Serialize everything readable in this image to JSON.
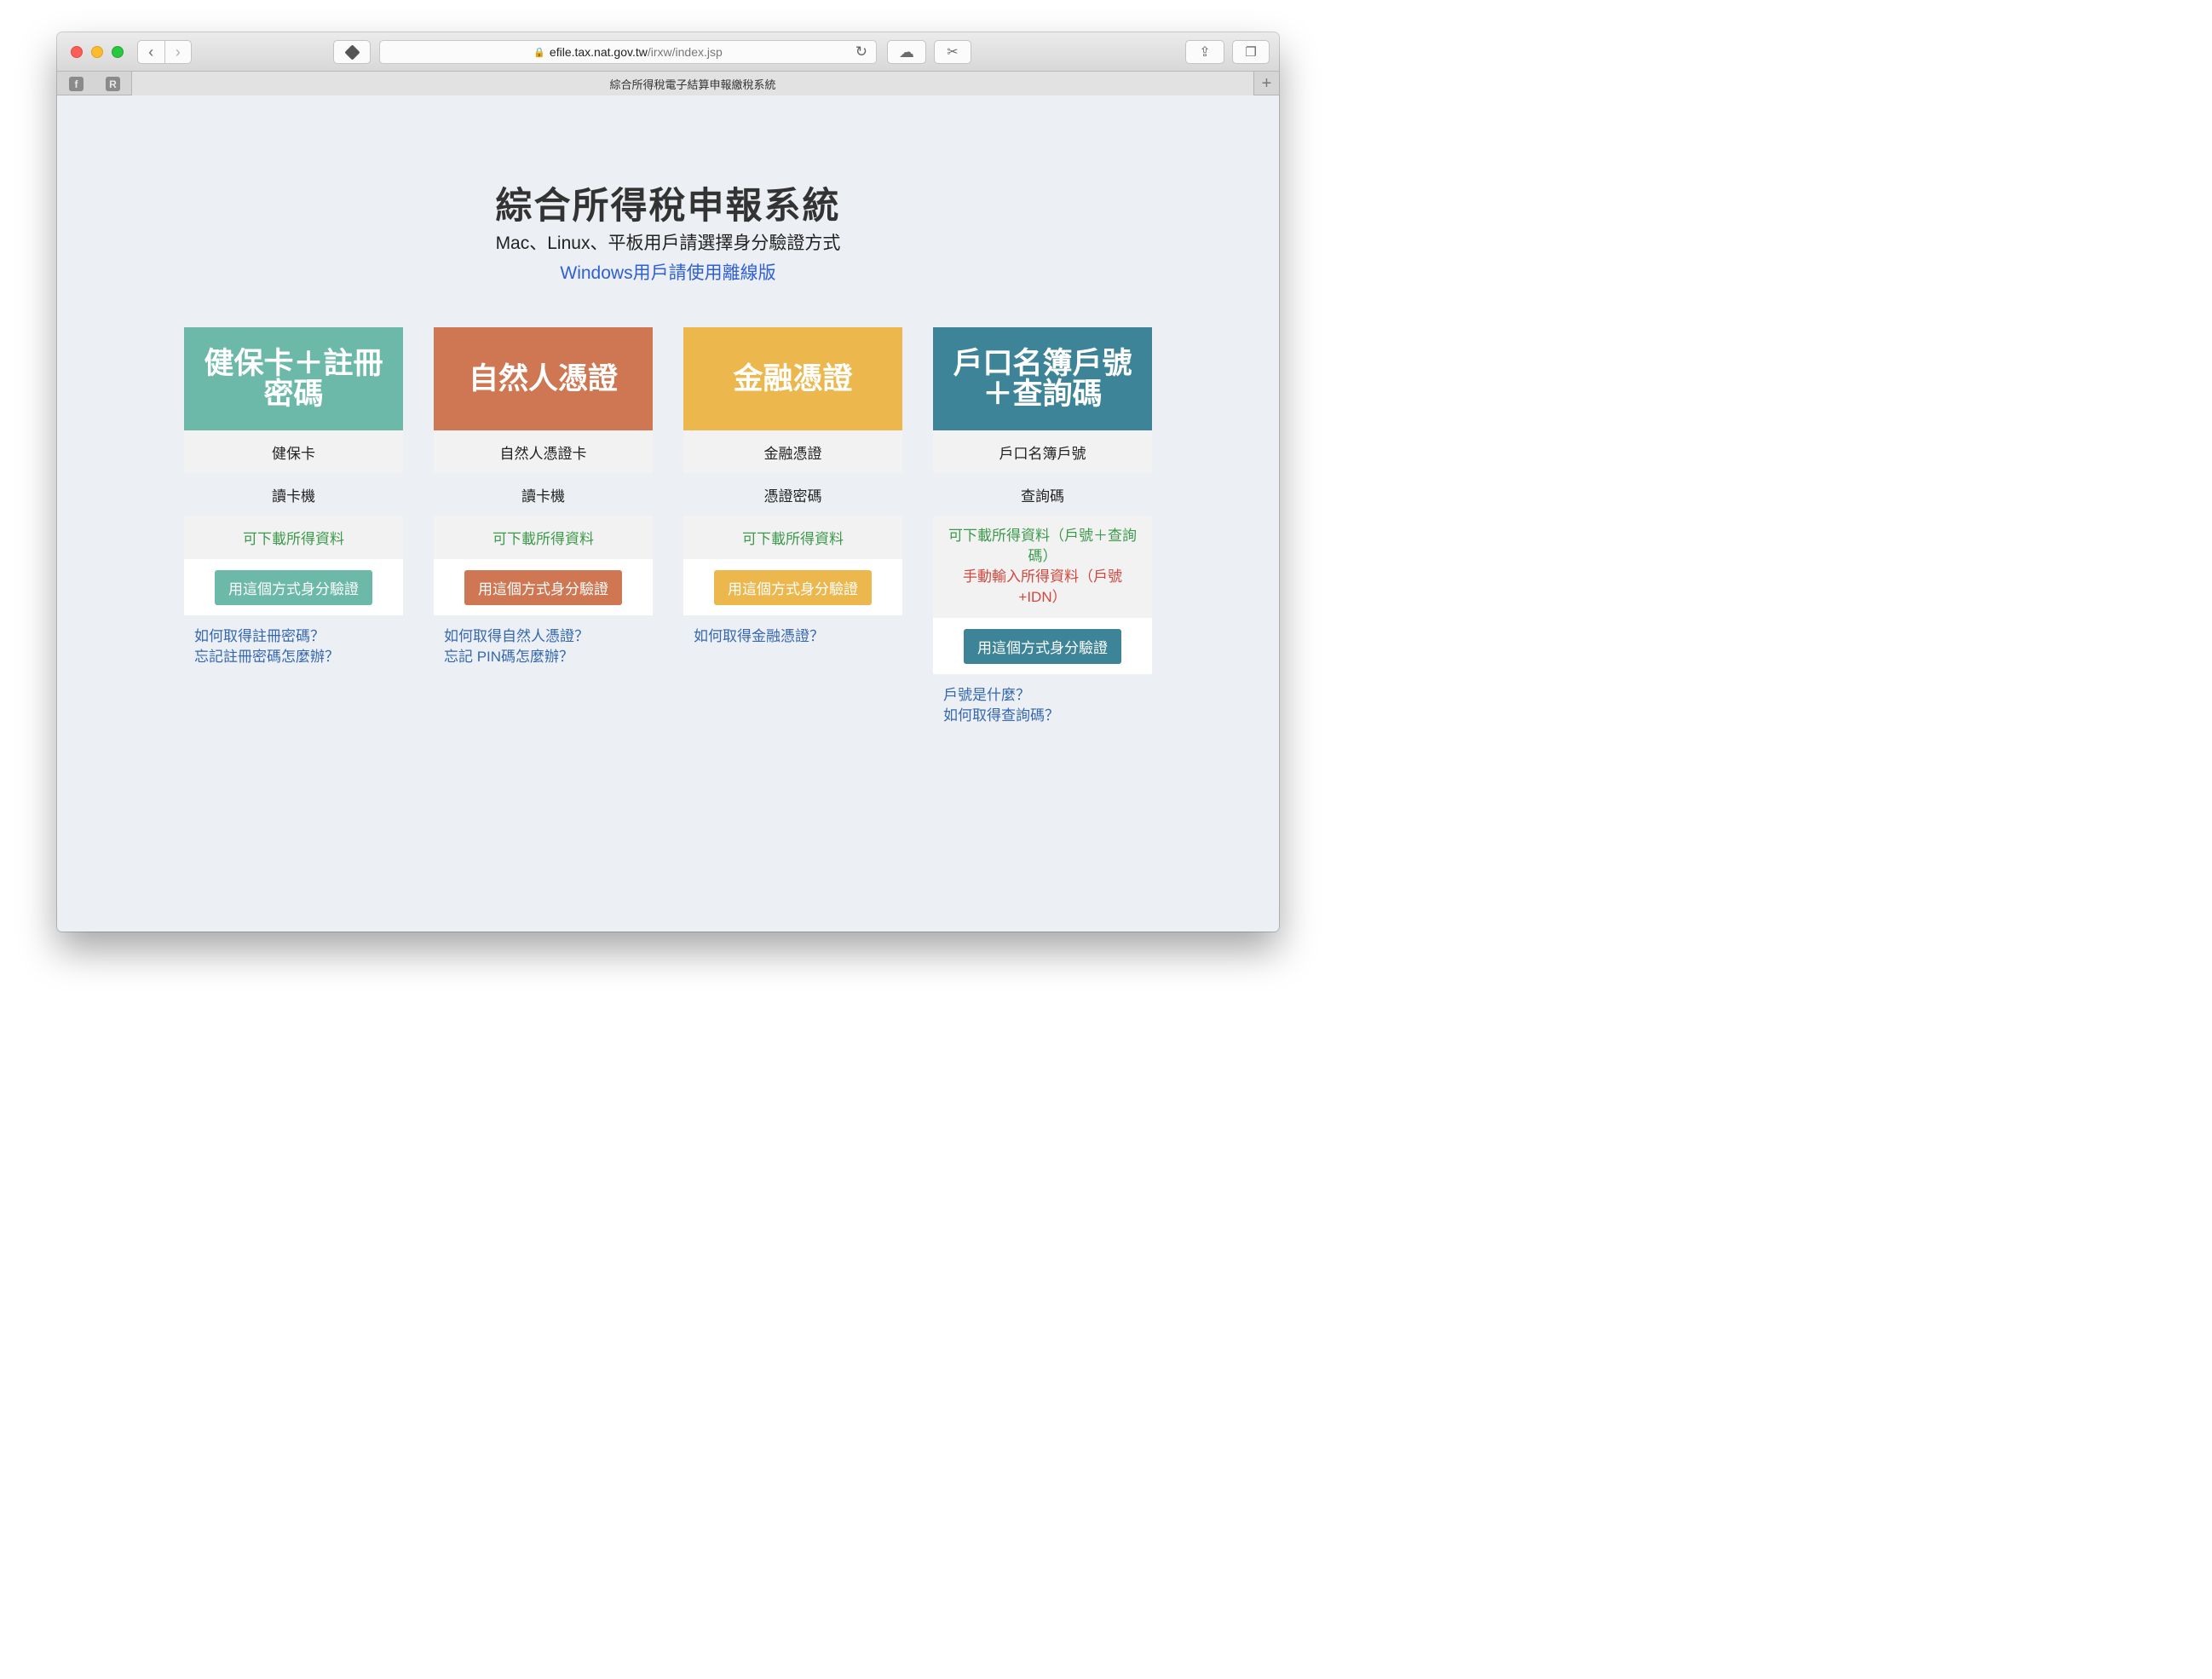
{
  "browser": {
    "url_host": "efile.tax.nat.gov.tw",
    "url_path": "/irxw/index.jsp",
    "tab_title": "綜合所得稅電子結算申報繳稅系統",
    "favorites": [
      "f",
      "R"
    ]
  },
  "page": {
    "title": "綜合所得稅申報系統",
    "subtitle": "Mac、Linux、平板用戶請選擇身分驗證方式",
    "windows_link": "Windows用戶請使用離線版"
  },
  "colors": {
    "card1": "#6cb9a9",
    "card2": "#cf7652",
    "card3": "#ecb74c",
    "card4": "#3d8498"
  },
  "cards": [
    {
      "title_line1": "健保卡＋註冊",
      "title_line2": "密碼",
      "row1": "健保卡",
      "row2": "讀卡機",
      "row3": "可下載所得資料",
      "button": "用這個方式身分驗證",
      "link1": "如何取得註冊密碼？",
      "link2": "忘記註冊密碼怎麼辦？"
    },
    {
      "title_line1": "自然人憑證",
      "row1": "自然人憑證卡",
      "row2": "讀卡機",
      "row3": "可下載所得資料",
      "button": "用這個方式身分驗證",
      "link1": "如何取得自然人憑證？",
      "link2": "忘記 PIN碼怎麼辦？"
    },
    {
      "title_line1": "金融憑證",
      "row1": "金融憑證",
      "row2": "憑證密碼",
      "row3": "可下載所得資料",
      "button": "用這個方式身分驗證",
      "link1": "如何取得金融憑證？"
    },
    {
      "title_line1": "戶口名簿戶號",
      "title_line2": "＋查詢碼",
      "row1": "戶口名簿戶號",
      "row2": "查詢碼",
      "row3_line1": "可下載所得資料（戶號＋查詢",
      "row3_line2": "碼）",
      "row3_red_line1": "手動輸入所得資料（戶號",
      "row3_red_line2": "+IDN）",
      "button": "用這個方式身分驗證",
      "link1": "戶號是什麼？",
      "link2": "如何取得查詢碼？"
    }
  ]
}
